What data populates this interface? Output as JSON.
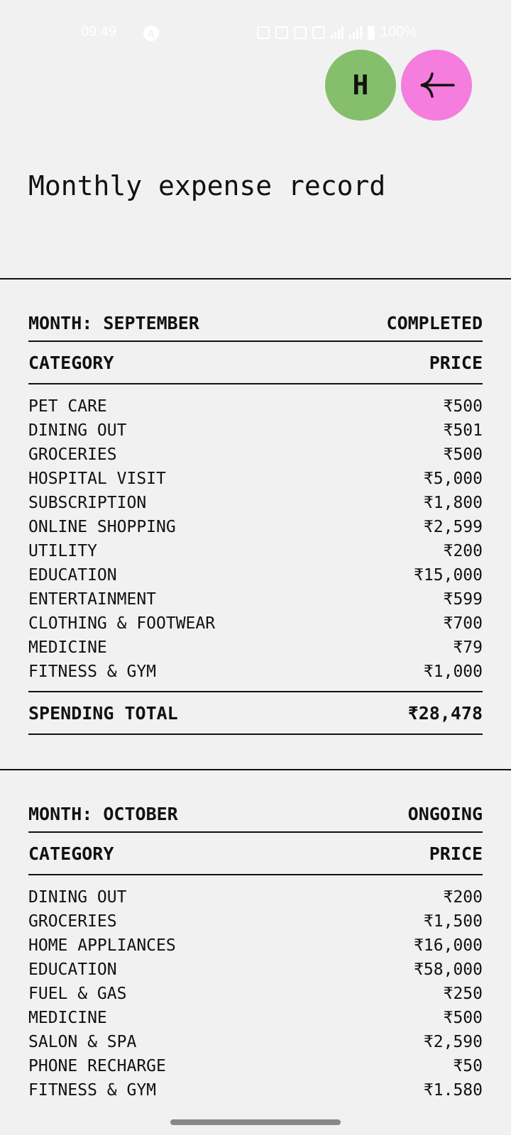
{
  "status_bar": {
    "time": "09:49",
    "battery": "100%"
  },
  "header": {
    "avatar_letter": "H",
    "back_icon": "back-arrow-icon",
    "title": "Monthly expense record"
  },
  "months": [
    {
      "title": "MONTH: SEPTEMBER",
      "status": "COMPLETED",
      "col_category": "CATEGORY",
      "col_price": "PRICE",
      "items": [
        {
          "name": "PET CARE",
          "price": "₹500"
        },
        {
          "name": "DINING OUT",
          "price": "₹501"
        },
        {
          "name": "GROCERIES",
          "price": "₹500"
        },
        {
          "name": "HOSPITAL VISIT",
          "price": "₹5,000"
        },
        {
          "name": "SUBSCRIPTION",
          "price": "₹1,800"
        },
        {
          "name": "ONLINE SHOPPING",
          "price": "₹2,599"
        },
        {
          "name": "UTILITY",
          "price": "₹200"
        },
        {
          "name": "EDUCATION",
          "price": "₹15,000"
        },
        {
          "name": "ENTERTAINMENT",
          "price": "₹599"
        },
        {
          "name": "CLOTHING & FOOTWEAR",
          "price": "₹700"
        },
        {
          "name": "MEDICINE",
          "price": "₹79"
        },
        {
          "name": "FITNESS & GYM",
          "price": "₹1,000"
        }
      ],
      "total_label": "SPENDING TOTAL",
      "total_value": "₹28,478"
    },
    {
      "title": "MONTH: OCTOBER",
      "status": "ONGOING",
      "col_category": "CATEGORY",
      "col_price": "PRICE",
      "items": [
        {
          "name": "DINING OUT",
          "price": "₹200"
        },
        {
          "name": "GROCERIES",
          "price": "₹1,500"
        },
        {
          "name": "HOME APPLIANCES",
          "price": "₹16,000"
        },
        {
          "name": "EDUCATION",
          "price": "₹58,000"
        },
        {
          "name": "FUEL & GAS",
          "price": "₹250"
        },
        {
          "name": "MEDICINE",
          "price": "₹500"
        },
        {
          "name": "SALON & SPA",
          "price": "₹2,590"
        },
        {
          "name": "PHONE RECHARGE",
          "price": "₹50"
        },
        {
          "name": "FITNESS & GYM",
          "price": "₹1.580"
        }
      ]
    }
  ]
}
